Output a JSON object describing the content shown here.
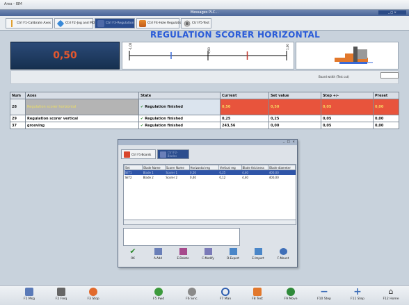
{
  "window": {
    "title": "Area - IBM",
    "message_bar": "Messages PLC..."
  },
  "tabs": [
    {
      "label": "Ctrl F1-Calibrate Axes",
      "active": false,
      "icon": "calibrate-icon"
    },
    {
      "label": "Ctrl F2-Jog and MDI",
      "active": false,
      "icon": "jog-icon"
    },
    {
      "label": "Ctrl F3-Regulation",
      "active": true,
      "icon": "regulation-icon"
    },
    {
      "label": "Ctrl F4-Hole Regulation",
      "active": false,
      "icon": "hole-icon"
    },
    {
      "label": "Ctrl F5-Test",
      "active": false,
      "icon": "test-icon"
    }
  ],
  "heading": "REGULATION SCORER HORIZONTAL",
  "current_value": "0,50",
  "gauge": {
    "min_label": "-1,00",
    "mid_label": "0,00",
    "max_label": "1,00",
    "pointer_value": 0.5
  },
  "board_width_label": "Board width (Test cut)",
  "axes_table": {
    "columns": [
      "Num",
      "Axes",
      "State",
      "Current",
      "Set value",
      "Step +/-",
      "Preset"
    ],
    "rows": [
      {
        "num": "28",
        "name": "Regulation scorer horizontal",
        "state": "Regulation finished",
        "current": "0,50",
        "set_value": "0,50",
        "step": "0,05",
        "preset": "0,00"
      },
      {
        "num": "29",
        "name": "Regulation scorer vertical",
        "state": "Regulation finished",
        "current": "0,25",
        "set_value": "0,25",
        "step": "0,05",
        "preset": "0,00"
      },
      {
        "num": "37",
        "name": "grooving",
        "state": "Regulation finished",
        "current": "243,56",
        "set_value": "0,00",
        "step": "0,05",
        "preset": "0,00"
      }
    ]
  },
  "dialog": {
    "window_buttons": "_ □ ×",
    "tabs": [
      {
        "label": "Ctrl F1-Boards",
        "active": false
      },
      {
        "label": "Ctrl F2-Blades",
        "active": true
      }
    ],
    "blades_table": {
      "columns": [
        "Set",
        "Blade Name",
        "Scorer Name",
        "Horizontal reg",
        "Vertical reg",
        "Blade thickness",
        "Blade diameter"
      ],
      "rows": [
        {
          "set": "SET1",
          "blade": "Blade 1",
          "scorer": "Scorer 1",
          "hreg": "0,50",
          "vreg": "0,25",
          "thick": "4,40",
          "diam": "400,00",
          "selected": true
        },
        {
          "set": "SET2",
          "blade": "Blade 2",
          "scorer": "Scorer 2",
          "hreg": "0,40",
          "vreg": "0,12",
          "thick": "4,40",
          "diam": "400,00",
          "selected": false
        }
      ]
    },
    "buttons": [
      {
        "label": "OK",
        "icon": "check-icon",
        "color": "#2d8a2d"
      },
      {
        "label": "A-Add",
        "icon": "add-icon",
        "color": "#6a7fb8"
      },
      {
        "label": "E-Delete",
        "icon": "delete-icon",
        "color": "#a64a8c"
      },
      {
        "label": "C-Modify",
        "icon": "modify-icon",
        "color": "#7a7ab8"
      },
      {
        "label": "D-Export",
        "icon": "export-icon",
        "color": "#4a86c8"
      },
      {
        "label": "E-Import",
        "icon": "import-icon",
        "color": "#4a86c8"
      },
      {
        "label": "F-Mount",
        "icon": "mount-icon",
        "color": "#3f6fb8"
      }
    ]
  },
  "footer": [
    {
      "label": "F1 Msg",
      "icon": "message-icon",
      "color": "#5a7ab8"
    },
    {
      "label": "F2 Freq",
      "icon": "frequency-icon",
      "color": "#666"
    },
    {
      "label": "F3 Stop",
      "icon": "stop-icon",
      "color": "#e26a2c"
    },
    {
      "label": "F5 Pwd",
      "icon": "power-icon",
      "color": "#3c9a3c"
    },
    {
      "label": "F6 Sinc.",
      "icon": "sync-icon",
      "color": "#8a8a8a"
    },
    {
      "label": "F7 Man",
      "icon": "manual-icon",
      "color": "#2f5fb0"
    },
    {
      "label": "F8 Test",
      "icon": "test-icon",
      "color": "#e2782c"
    },
    {
      "label": "F9 Move",
      "icon": "move-icon",
      "color": "#2f8a3a"
    },
    {
      "label": "F10 Step",
      "icon": "minus-icon",
      "color": "#3f6fb8"
    },
    {
      "label": "F11 Step",
      "icon": "plus-icon",
      "color": "#3f6fb8"
    },
    {
      "label": "F12 Home",
      "icon": "home-icon",
      "color": "#333"
    }
  ],
  "colors": {
    "heading": "#2a5bd8",
    "value_text": "#e4572e",
    "alarm_cell": "#e8543c",
    "active_tab": "#2b4d8e"
  }
}
